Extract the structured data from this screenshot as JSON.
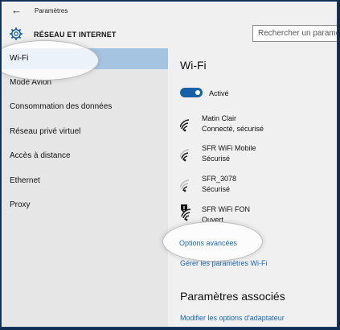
{
  "window": {
    "app_title": "Paramètres"
  },
  "header": {
    "title": "RÉSEAU ET INTERNET",
    "search_placeholder": "Rechercher un paramètre"
  },
  "sidebar": {
    "items": [
      {
        "label": "Wi-Fi",
        "selected": true
      },
      {
        "label": "Mode Avion"
      },
      {
        "label": "Consommation des données"
      },
      {
        "label": "Réseau privé virtuel"
      },
      {
        "label": "Accès à distance"
      },
      {
        "label": "Ethernet"
      },
      {
        "label": "Proxy"
      }
    ]
  },
  "main": {
    "title": "Wi-Fi",
    "wifi_toggle": {
      "state": "Activé",
      "on": true
    },
    "networks": [
      {
        "name": "Matin Clair",
        "status": "Connecté, sécurisé",
        "icon": "wifi-signal-icon"
      },
      {
        "name": "SFR WiFi Mobile",
        "status": "Sécurisé",
        "icon": "wifi-signal-icon"
      },
      {
        "name": "SFR_3078",
        "status": "Sécurisé",
        "icon": "wifi-signal-icon"
      },
      {
        "name": "SFR WiFi FON",
        "status": "Ouvert",
        "icon": "wifi-signal-warning-icon"
      }
    ],
    "advanced_options": "Options avancées",
    "manage_settings": "Gérer les paramètres Wi-Fi",
    "related_title": "Paramètres associés",
    "adapter_options": "Modifier les options d'adaptateur"
  },
  "colors": {
    "accent": "#1560a7",
    "link": "#1a66b3",
    "selected_nav": "#a4c4e1",
    "sidebar_bg": "#e6e6e6",
    "desktop_bg": "#0f2d52"
  }
}
